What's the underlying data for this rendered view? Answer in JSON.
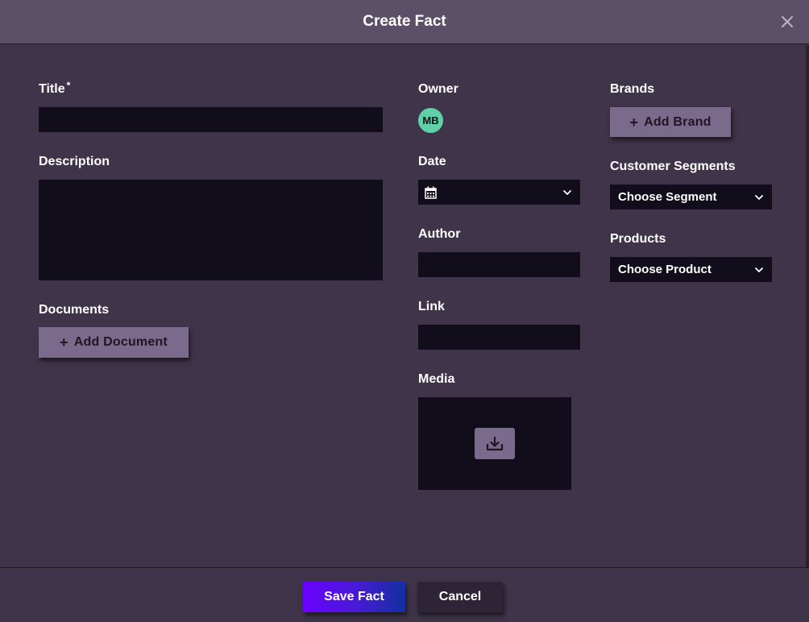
{
  "modal": {
    "title": "Create Fact",
    "close_icon": "close-icon"
  },
  "form": {
    "title": {
      "label": "Title",
      "required_mark": "*",
      "value": ""
    },
    "description": {
      "label": "Description",
      "value": ""
    },
    "documents": {
      "label": "Documents",
      "add_label": "Add Document",
      "add_icon": "plus-icon"
    },
    "owner": {
      "label": "Owner",
      "initials": "MB"
    },
    "date": {
      "label": "Date",
      "value": "",
      "icon": "calendar-icon"
    },
    "author": {
      "label": "Author",
      "value": ""
    },
    "link": {
      "label": "Link",
      "value": ""
    },
    "media": {
      "label": "Media",
      "upload_icon": "download-tray-icon"
    },
    "brands": {
      "label": "Brands",
      "add_label": "Add Brand",
      "add_icon": "plus-icon"
    },
    "segments": {
      "label": "Customer Segments",
      "selected": "Choose Segment"
    },
    "products": {
      "label": "Products",
      "selected": "Choose Product"
    }
  },
  "footer": {
    "save_label": "Save Fact",
    "cancel_label": "Cancel"
  },
  "colors": {
    "background": "#3f3449",
    "header": "#5c4f68",
    "input": "#110d1a",
    "secondary_button": "#7a6a8c",
    "avatar": "#5fd0a7",
    "save_gradient_start": "#6a00ff",
    "save_gradient_end": "#122fa0"
  }
}
